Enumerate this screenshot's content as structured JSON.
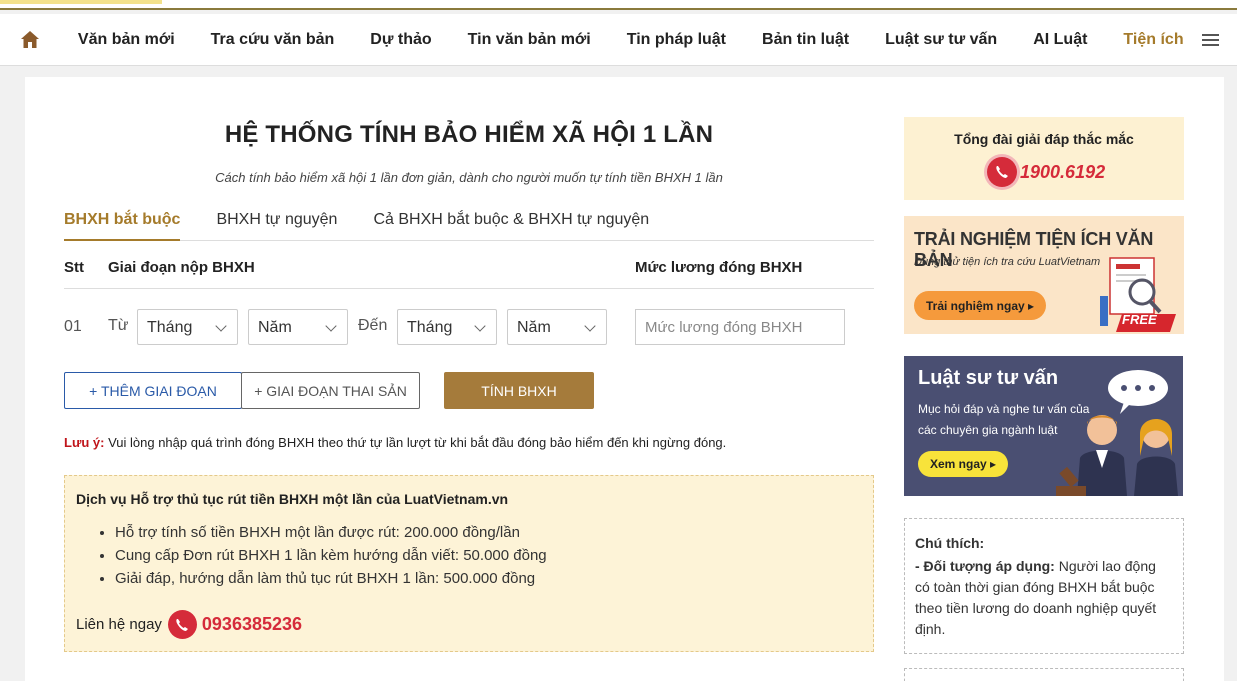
{
  "nav": {
    "items": [
      {
        "label": "Văn bản mới"
      },
      {
        "label": "Tra cứu văn bản"
      },
      {
        "label": "Dự thảo"
      },
      {
        "label": "Tin văn bản mới"
      },
      {
        "label": "Tin pháp luật"
      },
      {
        "label": "Bản tin luật"
      },
      {
        "label": "Luật sư tư vấn"
      },
      {
        "label": "AI Luật"
      },
      {
        "label": "Tiện ích"
      }
    ],
    "active_index": 8
  },
  "page": {
    "title": "HỆ THỐNG TÍNH BẢO HIỂM XÃ HỘI 1 LẦN",
    "subtitle": "Cách tính bảo hiểm xã hội 1 lần đơn giản, dành cho người muốn tự tính tiền BHXH 1 lần"
  },
  "tabs": [
    {
      "label": "BHXH bắt buộc",
      "active": true
    },
    {
      "label": "BHXH tự nguyện",
      "active": false
    },
    {
      "label": "Cả BHXH bắt buộc & BHXH tự nguyện",
      "active": false
    }
  ],
  "table": {
    "headers": {
      "stt": "Stt",
      "period": "Giai đoạn nộp BHXH",
      "salary": "Mức lương đóng BHXH"
    },
    "row": {
      "index": "01",
      "from_label": "Từ",
      "to_label": "Đến",
      "from_month": "Tháng",
      "from_year": "Năm",
      "to_month": "Tháng",
      "to_year": "Năm",
      "salary_placeholder": "Mức lương đóng BHXH"
    }
  },
  "buttons": {
    "add_period": "+ THÊM GIAI ĐOẠN",
    "maternity_period": "+ GIAI ĐOẠN THAI SẢN",
    "calculate": "TÍNH BHXH"
  },
  "note": {
    "label": "Lưu ý:",
    "text": " Vui lòng nhập quá trình đóng BHXH theo thứ tự lần lượt từ khi bắt đầu đóng bảo hiểm đến khi ngừng đóng."
  },
  "service": {
    "heading": "Dịch vụ Hỗ trợ thủ tục rút tiền BHXH một lần của LuatVietnam.vn",
    "items": [
      "Hỗ trợ tính số tiền BHXH một lần được rút: 200.000 đồng/lần",
      "Cung cấp Đơn rút BHXH 1 lần kèm hướng dẫn viết: 50.000 đồng",
      "Giải đáp, hướng dẫn làm thủ tục rút BHXH 1 lần: 500.000 đồng"
    ],
    "contact_label": "Liên hệ ngay",
    "contact_phone": "0936385236"
  },
  "sidebar": {
    "hotline": {
      "title": "Tổng đài giải đáp thắc mắc",
      "phone": "1900.6192"
    },
    "banner1": {
      "heading": "TRẢI NGHIỆM TIỆN ÍCH VĂN BẢN",
      "sub": "Dùng thử tiện ích tra cứu LuatVietnam",
      "button": "Trải nghiệm ngay ▸",
      "badge": "FREE"
    },
    "banner2": {
      "heading": "Luật sư tư vấn",
      "sub": "Mục hỏi đáp và nghe tư vấn của các chuyên gia ngành luật",
      "button": "Xem ngay ▸"
    },
    "legend": {
      "title": "Chú thích:",
      "label": "- Đối tượng áp dụng:",
      "text": " Người lao động có toàn thời gian đóng BHXH bắt buộc theo tiền lương do doanh nghiệp quyết định."
    }
  },
  "colors": {
    "accent": "#a57b2b",
    "phone_red": "#d52b3a",
    "link_blue": "#2a5aa8"
  }
}
